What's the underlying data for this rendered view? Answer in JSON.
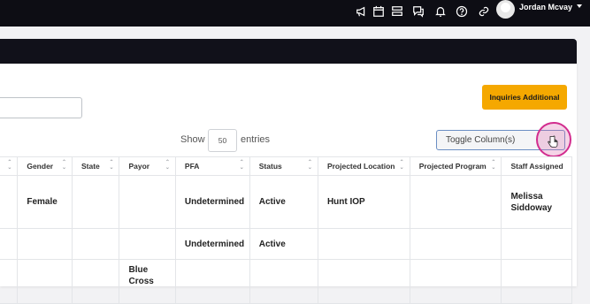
{
  "topbar": {
    "icons": [
      "megaphone-icon",
      "calendar-icon",
      "list-icon",
      "chat-icon",
      "bell-icon",
      "help-icon",
      "link-icon"
    ],
    "user_name": "Jordan Mcvay"
  },
  "toolbar": {
    "inquiries_button": "Inquiries Additional",
    "show_label": "Show",
    "page_size": "50",
    "entries_label": "entries",
    "toggle_columns": "Toggle Column(s)"
  },
  "table": {
    "columns": [
      "",
      "Gender",
      "State",
      "Payor",
      "PFA",
      "Status",
      "Projected Location",
      "Projected Program",
      "Staff Assigned"
    ],
    "rows": [
      [
        "",
        "Female",
        "",
        "",
        "Undetermined",
        "Active",
        "Hunt IOP",
        "",
        "Melissa Siddoway"
      ],
      [
        "",
        "",
        "",
        "",
        "Undetermined",
        "Active",
        "",
        "",
        ""
      ],
      [
        "",
        "",
        "",
        "Blue Cross",
        "",
        "",
        "",
        "",
        ""
      ]
    ]
  },
  "colors": {
    "accent_button": "#f5a800",
    "topbar": "#0d0d14",
    "cursor_ring": "#d22c8e"
  }
}
